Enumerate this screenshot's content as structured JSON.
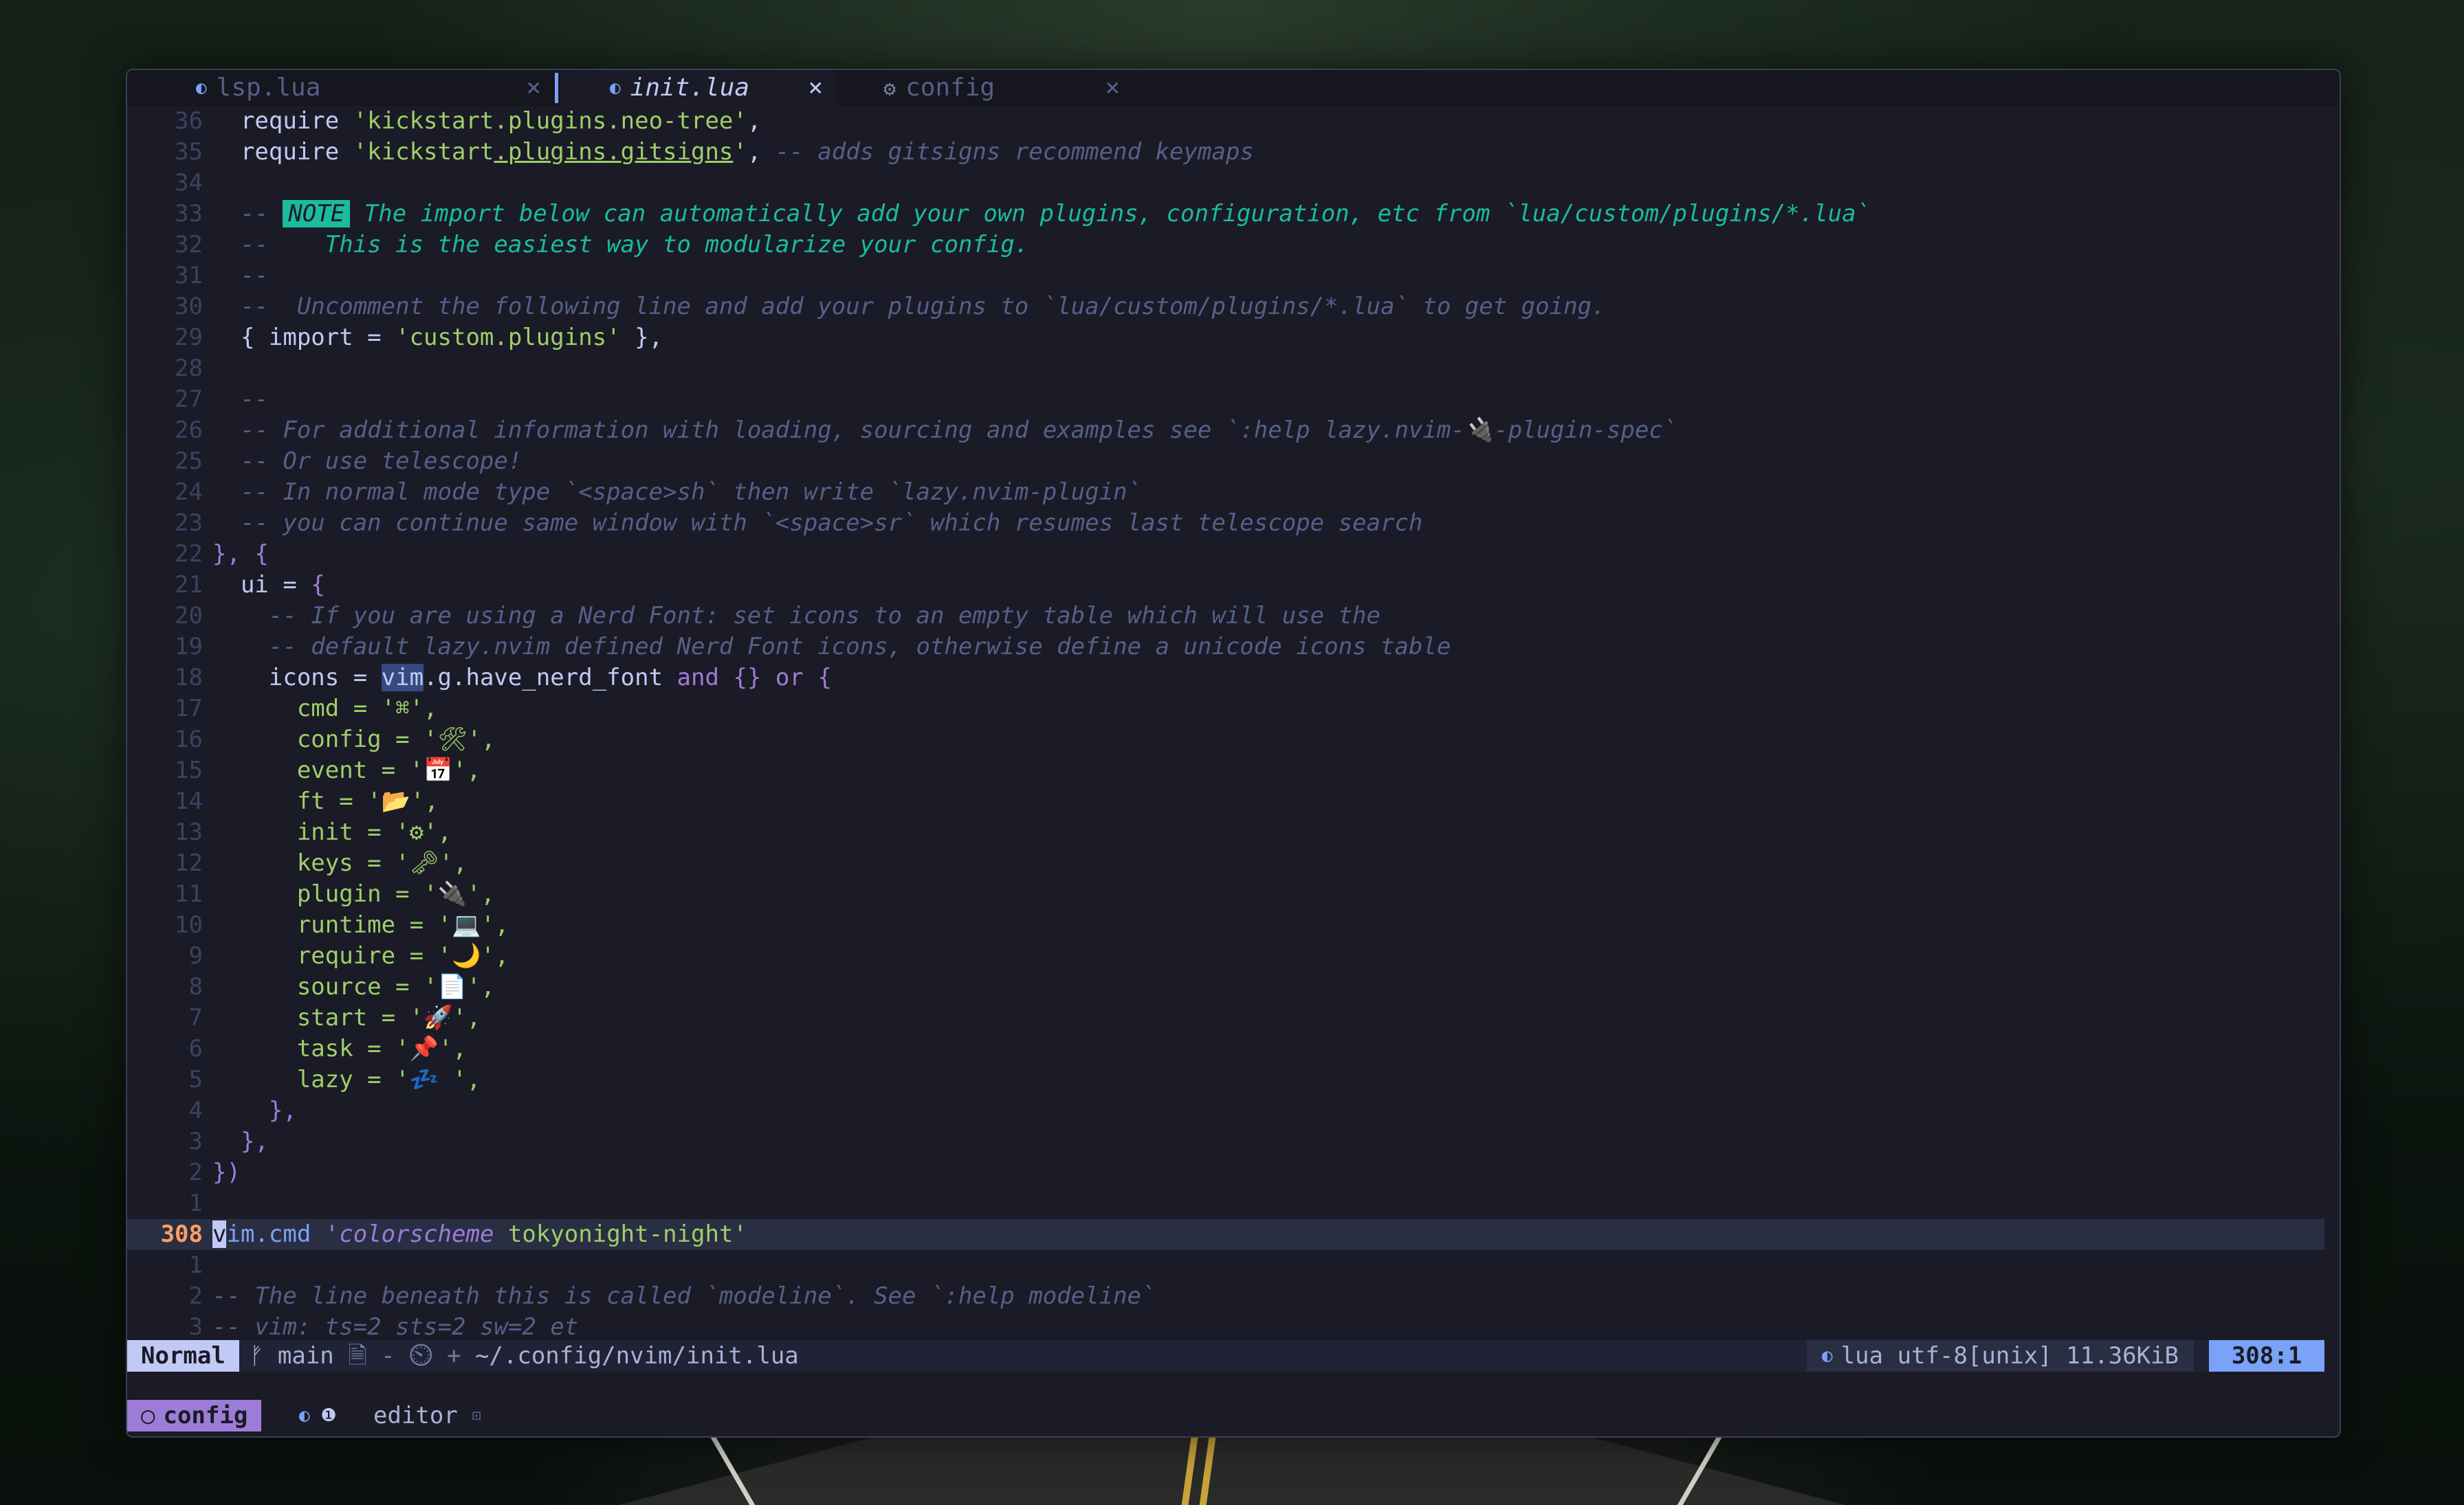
{
  "tabs": [
    {
      "label": "lsp.lua",
      "icon": "lua-icon",
      "active": false
    },
    {
      "label": "init.lua",
      "icon": "lua-icon",
      "active": true
    },
    {
      "label": "config",
      "icon": "gear-icon",
      "active": false
    }
  ],
  "tab_close_glyph": "×",
  "lines": [
    {
      "num": "36",
      "code": "  require 'kickstart.plugins.neo-tree',"
    },
    {
      "num": "35",
      "code": "  require 'kickstart.plugins.gitsigns', -- adds gitsigns recommend keymaps"
    },
    {
      "num": "34",
      "code": ""
    },
    {
      "num": "33",
      "code": "  -- NOTE The import below can automatically add your own plugins, configuration, etc from `lua/custom/plugins/*.lua`"
    },
    {
      "num": "32",
      "code": "  --    This is the easiest way to modularize your config."
    },
    {
      "num": "31",
      "code": "  --"
    },
    {
      "num": "30",
      "code": "  --  Uncomment the following line and add your plugins to `lua/custom/plugins/*.lua` to get going."
    },
    {
      "num": "29",
      "code": "  { import = 'custom.plugins' },"
    },
    {
      "num": "28",
      "code": ""
    },
    {
      "num": "27",
      "code": "  --"
    },
    {
      "num": "26",
      "code": "  -- For additional information with loading, sourcing and examples see `:help lazy.nvim-🔌-plugin-spec`"
    },
    {
      "num": "25",
      "code": "  -- Or use telescope!"
    },
    {
      "num": "24",
      "code": "  -- In normal mode type `<space>sh` then write `lazy.nvim-plugin`"
    },
    {
      "num": "23",
      "code": "  -- you can continue same window with `<space>sr` which resumes last telescope search"
    },
    {
      "num": "22",
      "code": "}, {"
    },
    {
      "num": "21",
      "code": "  ui = {"
    },
    {
      "num": "20",
      "code": "    -- If you are using a Nerd Font: set icons to an empty table which will use the"
    },
    {
      "num": "19",
      "code": "    -- default lazy.nvim defined Nerd Font icons, otherwise define a unicode icons table"
    },
    {
      "num": "18",
      "code": "    icons = vim.g.have_nerd_font and {} or {"
    },
    {
      "num": "17",
      "code": "      cmd = '⌘',"
    },
    {
      "num": "16",
      "code": "      config = '🛠',"
    },
    {
      "num": "15",
      "code": "      event = '📅',"
    },
    {
      "num": "14",
      "code": "      ft = '📂',"
    },
    {
      "num": "13",
      "code": "      init = '⚙',"
    },
    {
      "num": "12",
      "code": "      keys = '🗝',"
    },
    {
      "num": "11",
      "code": "      plugin = '🔌',"
    },
    {
      "num": "10",
      "code": "      runtime = '💻',"
    },
    {
      "num": "9",
      "code": "      require = '🌙',"
    },
    {
      "num": "8",
      "code": "      source = '📄',"
    },
    {
      "num": "7",
      "code": "      start = '🚀',"
    },
    {
      "num": "6",
      "code": "      task = '📌',"
    },
    {
      "num": "5",
      "code": "      lazy = '💤 ',"
    },
    {
      "num": "4",
      "code": "    },"
    },
    {
      "num": "3",
      "code": "  },"
    },
    {
      "num": "2",
      "code": "})"
    },
    {
      "num": "1",
      "code": ""
    },
    {
      "num": "308",
      "code": "vim.cmd 'colorscheme tokyonight-night'"
    },
    {
      "num": "1",
      "code": ""
    },
    {
      "num": "2",
      "code": "-- The line beneath this is called `modeline`. See `:help modeline`"
    },
    {
      "num": "3",
      "code": "-- vim: ts=2 sts=2 sw=2 et"
    }
  ],
  "statusline": {
    "mode": "Normal",
    "branch_glyph": "ᚠ",
    "branch": "main",
    "git_extra": "🗎 - ⏲ +",
    "path": "~/.config/nvim/init.lua",
    "filetype": "lua",
    "encoding": "utf-8[unix]",
    "size": "11.36KiB",
    "position": "308:1"
  },
  "tmux": {
    "circle": "○",
    "session": "config",
    "window1_marker": "❶",
    "window2": "editor",
    "window2_marker": "⊡"
  },
  "colors": {
    "background": "#1a1b26",
    "comment": "#565f89",
    "string": "#9ece6a",
    "keyword": "#9d7cd8",
    "function": "#7aa2f7",
    "note": "#1abc9c",
    "line_number_current": "#ff9e64"
  }
}
